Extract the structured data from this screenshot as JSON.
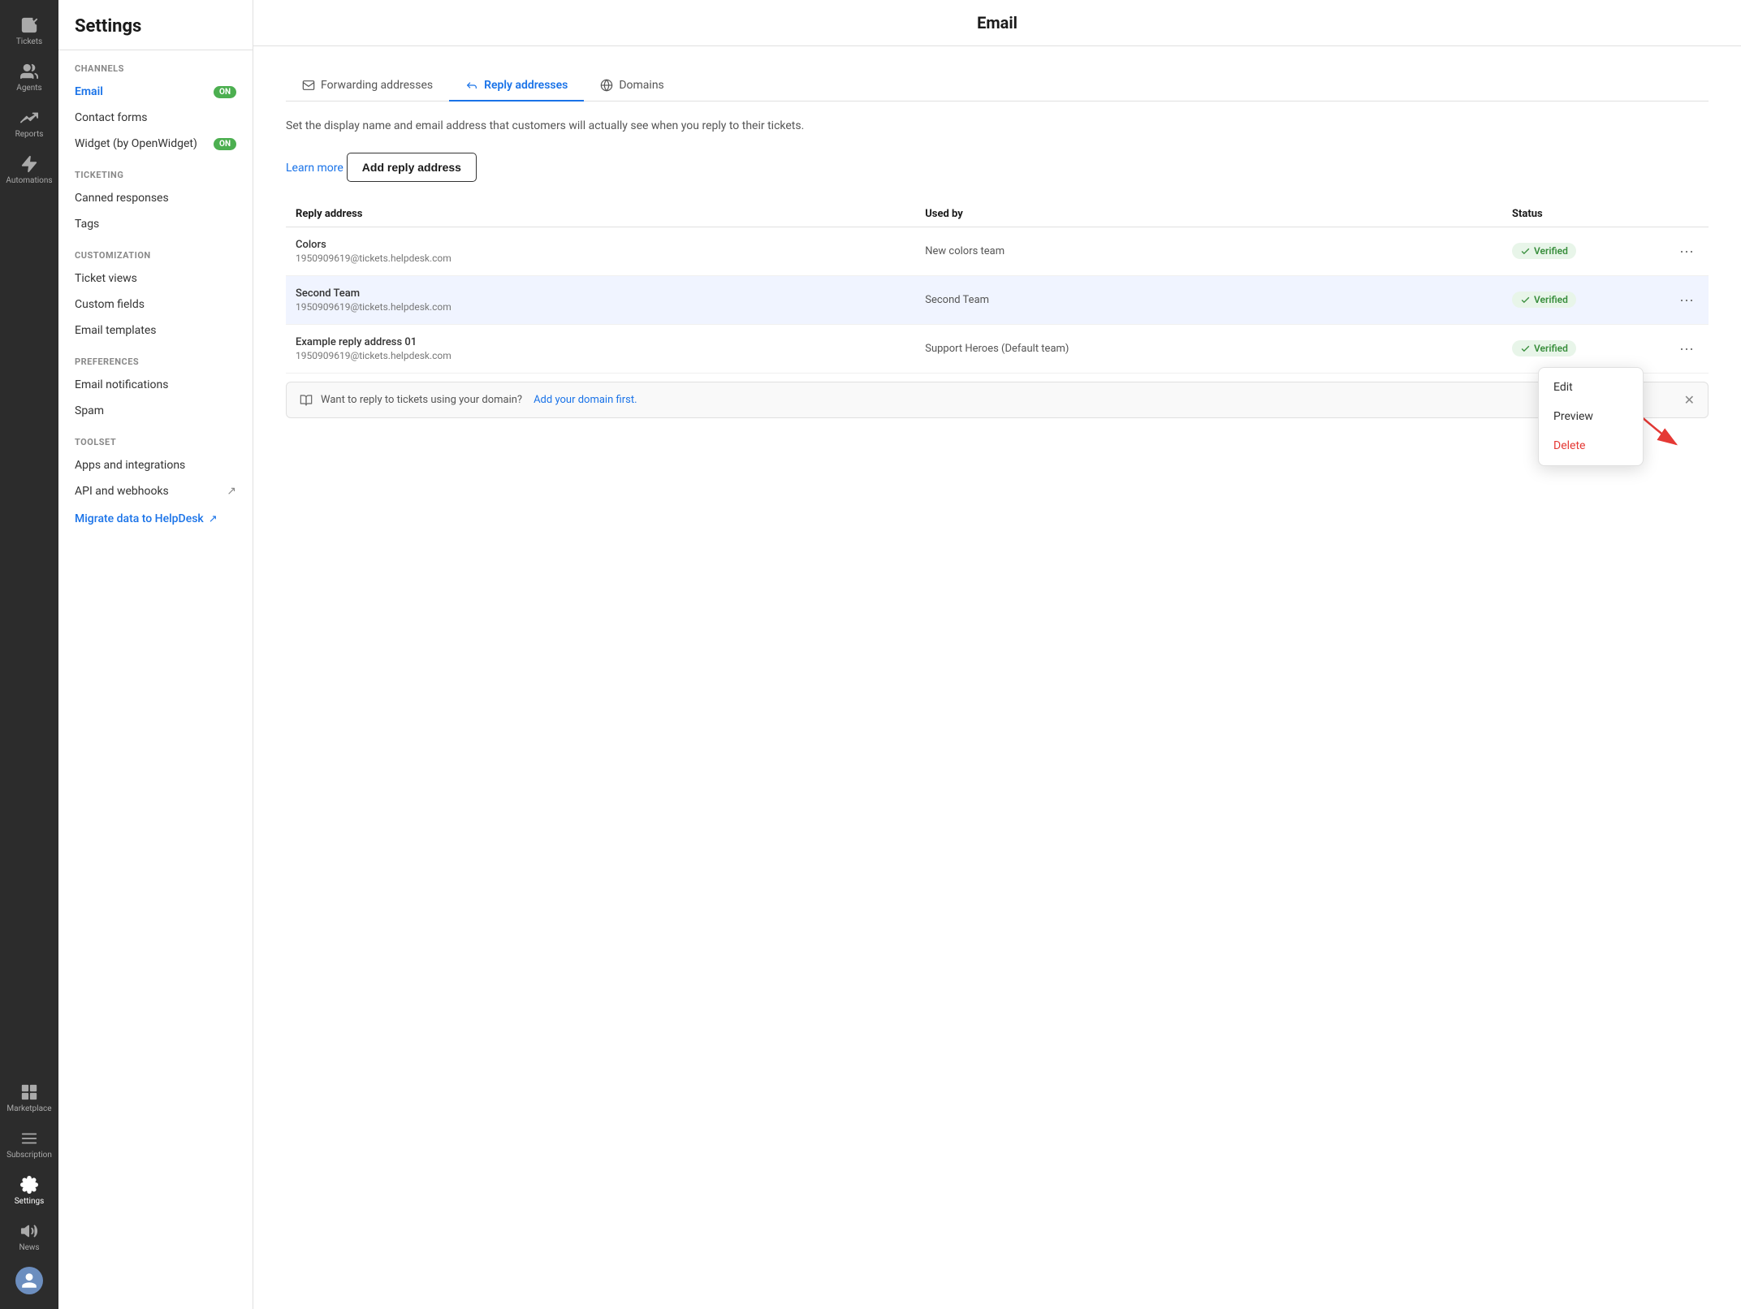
{
  "iconNav": {
    "items": [
      {
        "id": "tickets",
        "label": "Tickets",
        "icon": "check-square"
      },
      {
        "id": "agents",
        "label": "Agents",
        "icon": "users"
      },
      {
        "id": "reports",
        "label": "Reports",
        "icon": "trending-up"
      },
      {
        "id": "automations",
        "label": "Automations",
        "icon": "zap"
      },
      {
        "id": "marketplace",
        "label": "Marketplace",
        "icon": "grid"
      },
      {
        "id": "subscription",
        "label": "Subscription",
        "icon": "menu"
      },
      {
        "id": "settings",
        "label": "Settings",
        "icon": "settings",
        "active": true
      },
      {
        "id": "news",
        "label": "News",
        "icon": "volume-2"
      }
    ]
  },
  "sidebar": {
    "title": "Settings",
    "sections": [
      {
        "label": "Channels",
        "items": [
          {
            "id": "email",
            "label": "Email",
            "badge": "ON",
            "active": true
          },
          {
            "id": "contact-forms",
            "label": "Contact forms"
          },
          {
            "id": "widget",
            "label": "Widget (by OpenWidget)",
            "badge": "ON"
          }
        ]
      },
      {
        "label": "Ticketing",
        "items": [
          {
            "id": "canned",
            "label": "Canned responses"
          },
          {
            "id": "tags",
            "label": "Tags"
          }
        ]
      },
      {
        "label": "Customization",
        "items": [
          {
            "id": "ticket-views",
            "label": "Ticket views"
          },
          {
            "id": "custom-fields",
            "label": "Custom fields"
          },
          {
            "id": "email-templates",
            "label": "Email templates"
          }
        ]
      },
      {
        "label": "Preferences",
        "items": [
          {
            "id": "email-notifications",
            "label": "Email notifications"
          },
          {
            "id": "spam",
            "label": "Spam"
          }
        ]
      },
      {
        "label": "Toolset",
        "items": [
          {
            "id": "apps",
            "label": "Apps and integrations"
          },
          {
            "id": "api",
            "label": "API and webhooks",
            "extIcon": true
          }
        ]
      }
    ],
    "migrateLink": "Migrate data to HelpDesk"
  },
  "main": {
    "header": "Email",
    "tabs": [
      {
        "id": "forwarding",
        "label": "Forwarding addresses",
        "icon": "mail"
      },
      {
        "id": "reply",
        "label": "Reply addresses",
        "icon": "reply",
        "active": true
      },
      {
        "id": "domains",
        "label": "Domains",
        "icon": "globe"
      }
    ],
    "description": "Set the display name and email address that customers will actually see when you reply to their tickets.",
    "learnMore": "Learn more",
    "addButton": "Add reply address",
    "table": {
      "columns": [
        "Reply address",
        "Used by",
        "Status"
      ],
      "rows": [
        {
          "id": "row1",
          "name": "Colors",
          "email": "1950909619@tickets.helpdesk.com",
          "usedBy": "New colors team",
          "status": "Verified"
        },
        {
          "id": "row2",
          "name": "Second Team",
          "email": "1950909619@tickets.helpdesk.com",
          "usedBy": "Second Team",
          "status": "Verified",
          "highlighted": true
        },
        {
          "id": "row3",
          "name": "Example reply address 01",
          "email": "1950909619@tickets.helpdesk.com",
          "usedBy": "Support Heroes (Default team)",
          "status": "Verified"
        }
      ]
    },
    "contextMenu": {
      "items": [
        {
          "id": "edit",
          "label": "Edit"
        },
        {
          "id": "preview",
          "label": "Preview"
        },
        {
          "id": "delete",
          "label": "Delete",
          "danger": true
        }
      ]
    },
    "domainNotice": {
      "text": "Want to reply to tickets using your domain?",
      "linkText": "Add your domain first.",
      "bookIcon": "book-open"
    }
  }
}
